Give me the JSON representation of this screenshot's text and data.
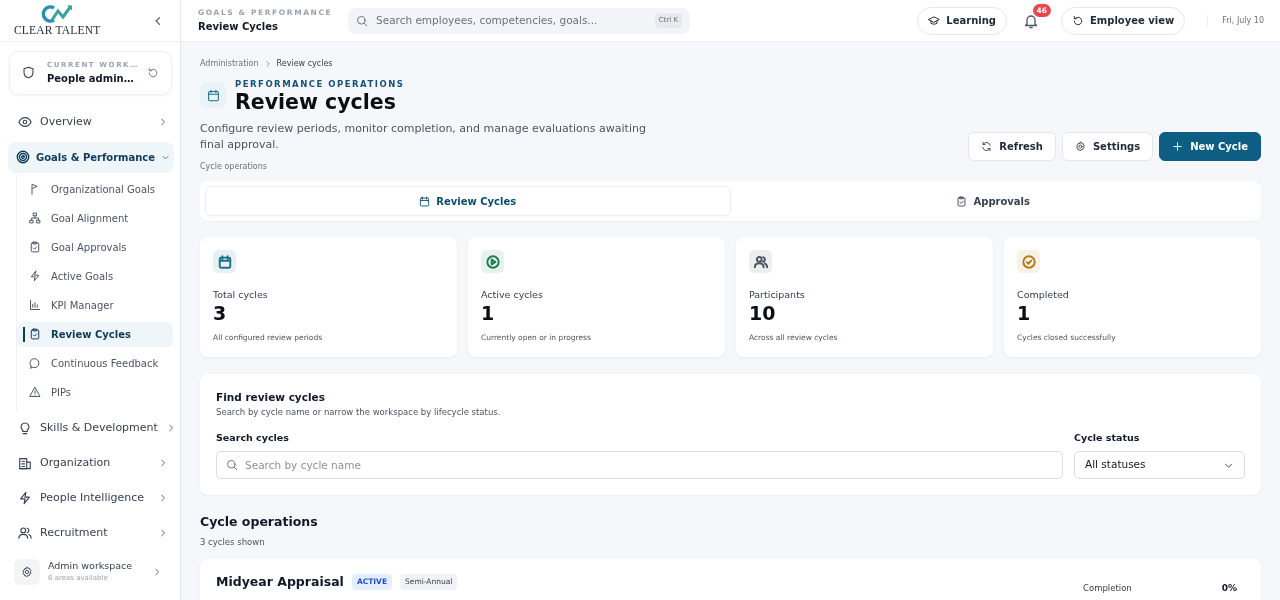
{
  "brand": {
    "name": "CLEAR TALENT"
  },
  "workspace": {
    "label": "CURRENT WORK…",
    "value": "People admin…"
  },
  "sidebar": {
    "items": [
      {
        "label": "Overview",
        "expanded": false,
        "selected": false
      },
      {
        "label": "Goals & Performance",
        "expanded": true,
        "selected": true,
        "children": [
          {
            "label": "Organizational Goals",
            "selected": false
          },
          {
            "label": "Goal Alignment",
            "selected": false
          },
          {
            "label": "Goal Approvals",
            "selected": false
          },
          {
            "label": "Active Goals",
            "selected": false
          },
          {
            "label": "KPI Manager",
            "selected": false
          },
          {
            "label": "Review Cycles",
            "selected": true
          },
          {
            "label": "Continuous Feedback",
            "selected": false
          },
          {
            "label": "PIPs",
            "selected": false
          }
        ]
      },
      {
        "label": "Skills & Development",
        "expanded": false,
        "selected": false
      },
      {
        "label": "Organization",
        "expanded": false,
        "selected": false
      },
      {
        "label": "People Intelligence",
        "expanded": false,
        "selected": false
      },
      {
        "label": "Recruitment",
        "expanded": false,
        "selected": false
      }
    ]
  },
  "admin": {
    "title": "Admin workspace",
    "subtitle": "6 areas available"
  },
  "topbar": {
    "section": "GOALS & PERFORMANCE",
    "page": "Review Cycles",
    "search": {
      "placeholder": "Search employees, competencies, goals...",
      "shortcut": "Ctrl K"
    },
    "learning": "Learning",
    "notifications": "46",
    "employee_view": "Employee view",
    "date": "Fri, July 10"
  },
  "breadcrumb": [
    "Administration",
    "Review cycles"
  ],
  "header": {
    "eyebrow": "PERFORMANCE OPERATIONS",
    "title": "Review cycles",
    "description": "Configure review periods, monitor completion, and manage evaluations awaiting final approval.",
    "caption": "Cycle operations"
  },
  "actions": [
    {
      "label": "Refresh",
      "kind": "outline"
    },
    {
      "label": "Settings",
      "kind": "outline"
    },
    {
      "label": "New Cycle",
      "kind": "primary"
    }
  ],
  "tabs": [
    {
      "label": "Review Cycles",
      "selected": true
    },
    {
      "label": "Approvals",
      "selected": false
    }
  ],
  "stats": [
    {
      "label": "Total cycles",
      "value": "3",
      "note": "All configured review periods",
      "color": "#1f6f8b"
    },
    {
      "label": "Active cycles",
      "value": "1",
      "note": "Currently open or in progress",
      "color": "#1e7a4f"
    },
    {
      "label": "Participants",
      "value": "10",
      "note": "Across all review cycles",
      "color": "#4b5563"
    },
    {
      "label": "Completed",
      "value": "1",
      "note": "Cycles closed successfully",
      "color": "#b7791f"
    }
  ],
  "filters": {
    "title": "Find review cycles",
    "description": "Search by cycle name or narrow the workspace by lifecycle status.",
    "search_label": "Search cycles",
    "search_placeholder": "Search by cycle name",
    "status_label": "Cycle status",
    "status_value": "All statuses"
  },
  "cycles": {
    "title": "Cycle operations",
    "count": "3 cycles shown",
    "items": [
      {
        "name": "Midyear Appraisal",
        "status": "ACTIVE",
        "period": "Semi-Annual",
        "completion_label": "Completion",
        "completion": "0%"
      }
    ]
  }
}
